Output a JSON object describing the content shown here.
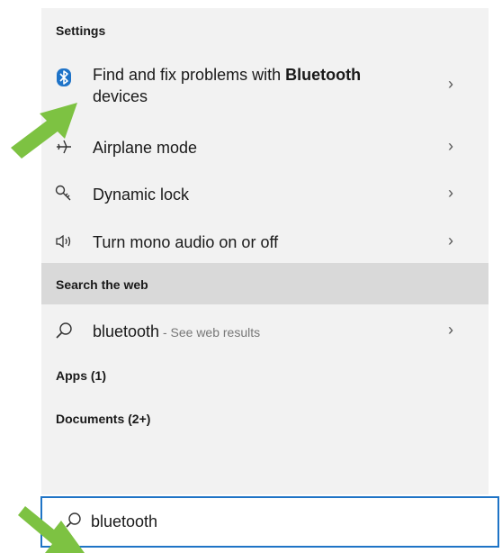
{
  "settings": {
    "heading": "Settings",
    "items": [
      {
        "label_pre": "Find and fix problems with ",
        "label_bold": "Bluetooth",
        "label_line2": "devices",
        "icon": "bluetooth-icon"
      },
      {
        "label": "Airplane mode",
        "icon": "airplane-icon"
      },
      {
        "label": "Dynamic lock",
        "icon": "key-icon"
      },
      {
        "label": "Turn mono audio on or off",
        "icon": "speaker-icon"
      }
    ]
  },
  "web": {
    "heading": "Search the web",
    "query": "bluetooth",
    "suffix": " - See web results"
  },
  "apps": {
    "heading": "Apps (1)"
  },
  "documents": {
    "heading": "Documents (2+)"
  },
  "searchbox": {
    "value": "bluetooth"
  },
  "colors": {
    "accent": "#1f74c6",
    "arrow": "#7dc242",
    "bluetooth": "#1e73c8"
  }
}
